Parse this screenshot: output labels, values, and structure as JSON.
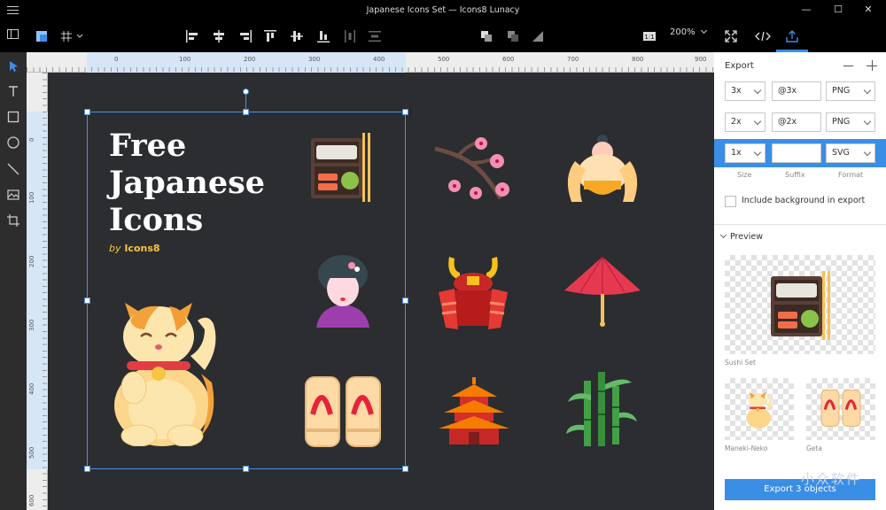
{
  "window": {
    "title": "Japanese Icons Set — Icons8 Lunacy",
    "minimize": "—",
    "maximize": "☐",
    "close": "✕"
  },
  "toolbar": {
    "zoom": "200%"
  },
  "ruler": {
    "top_ticks": [
      "0",
      "100",
      "200",
      "300",
      "400",
      "500",
      "600",
      "700",
      "800",
      "900"
    ],
    "left_ticks": [
      "0",
      "100",
      "200",
      "300",
      "400",
      "500",
      "600"
    ]
  },
  "artboard": {
    "heading_line1": "Free",
    "heading_line2": "Japanese",
    "heading_line3": "Icons",
    "by": "by",
    "brand": "Icons8"
  },
  "panel": {
    "export_title": "Export",
    "rows": [
      {
        "scale": "3x",
        "suffix": "@3x",
        "format": "PNG"
      },
      {
        "scale": "2x",
        "suffix": "@2x",
        "format": "PNG"
      },
      {
        "scale": "1x",
        "suffix": "",
        "format": "SVG"
      }
    ],
    "col_size": "Size",
    "col_suffix": "Suffix",
    "col_format": "Format",
    "include_bg": "Include background in export",
    "preview_title": "Preview",
    "preview_items": [
      "Sushi Set",
      "Maneki-Neko",
      "Geta"
    ],
    "export_button": "Export 3 objects"
  },
  "watermark": "小众软件",
  "colors": {
    "accent": "#3a8ee6",
    "byline": "#f6c443",
    "canvas": "#2b2d30"
  }
}
